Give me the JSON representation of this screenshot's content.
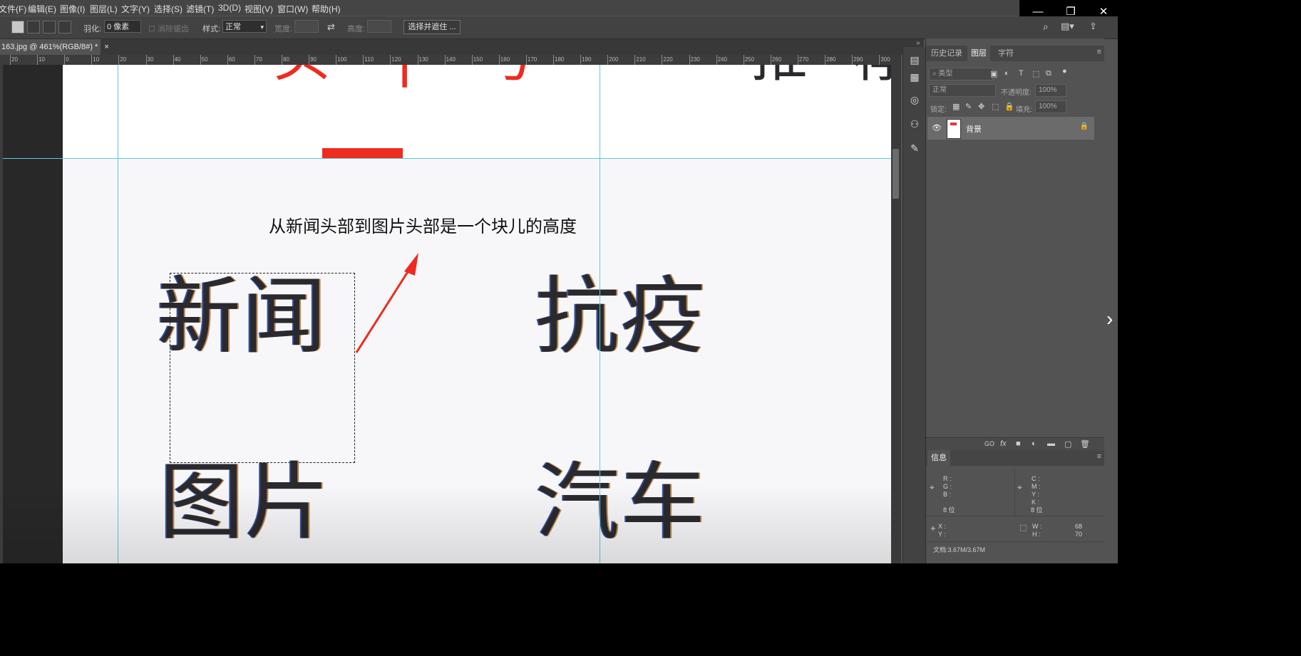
{
  "menubar": {
    "items": [
      "文件(F)",
      "编辑(E)",
      "图像(I)",
      "图层(L)",
      "文字(Y)",
      "选择(S)",
      "滤镜(T)",
      "3D(D)",
      "视图(V)",
      "窗口(W)",
      "帮助(H)"
    ]
  },
  "window_controls": {
    "minimize": "—",
    "restore": "❐",
    "close": "✕"
  },
  "options_bar": {
    "feather_label": "羽化:",
    "feather_value": "0 像素",
    "antialias_label": "消除锯齿",
    "style_label": "样式:",
    "style_value": "正常",
    "width_label": "宽度:",
    "height_label": "高度:",
    "swap_icon": "⇄",
    "select_mask_button": "选择并遮住 ..."
  },
  "document_tab": {
    "title": "163.jpg @ 461%(RGB/8#) *",
    "close": "×"
  },
  "ruler": {
    "labels": [
      "20",
      "10",
      "0",
      "10",
      "20",
      "30",
      "40",
      "50",
      "60",
      "70",
      "80",
      "90",
      "100",
      "110",
      "120",
      "130",
      "140",
      "150",
      "160",
      "170",
      "180",
      "190",
      "200",
      "210",
      "220",
      "230",
      "240",
      "250",
      "260",
      "270",
      "280",
      "290",
      "300"
    ]
  },
  "canvas": {
    "annotation": "从新闻头部到图片头部是一个块儿的高度",
    "top_cut_left": "头 | 号",
    "top_cut_right": "推 荐",
    "word_news": "新闻",
    "word_epidemic": "抗疫",
    "word_picture": "图片",
    "word_car": "汽车"
  },
  "panel": {
    "tabs": [
      "历史记录",
      "图层",
      "字符"
    ],
    "active_tab": "图层",
    "filter_kind": "类型",
    "blend_mode": "正常",
    "opacity_label": "不透明度:",
    "opacity_value": "100%",
    "lock_label": "锁定:",
    "fill_label": "填充:",
    "fill_value": "100%",
    "layer_name": "背景",
    "bottom_icons": [
      "GO",
      "fx",
      "■",
      "◐",
      "▬",
      "▢",
      "🗑"
    ]
  },
  "info_panel": {
    "title": "信息",
    "rgb_labels": "R :\nG :\nB :",
    "cmyk_labels": "C :\nM :\nY :\nK :",
    "bits_left": "8 位",
    "bits_right": "8 位",
    "xy_labels": "X :\nY :",
    "wh_labels": "W :\nH :",
    "w_value": "68",
    "h_value": "70",
    "doc_size": "文档:3.67M/3.67M"
  },
  "colors": {
    "accent_red": "#ee2b1f",
    "guide": "#5ec9dc",
    "arrow": "#ee2b1f"
  }
}
